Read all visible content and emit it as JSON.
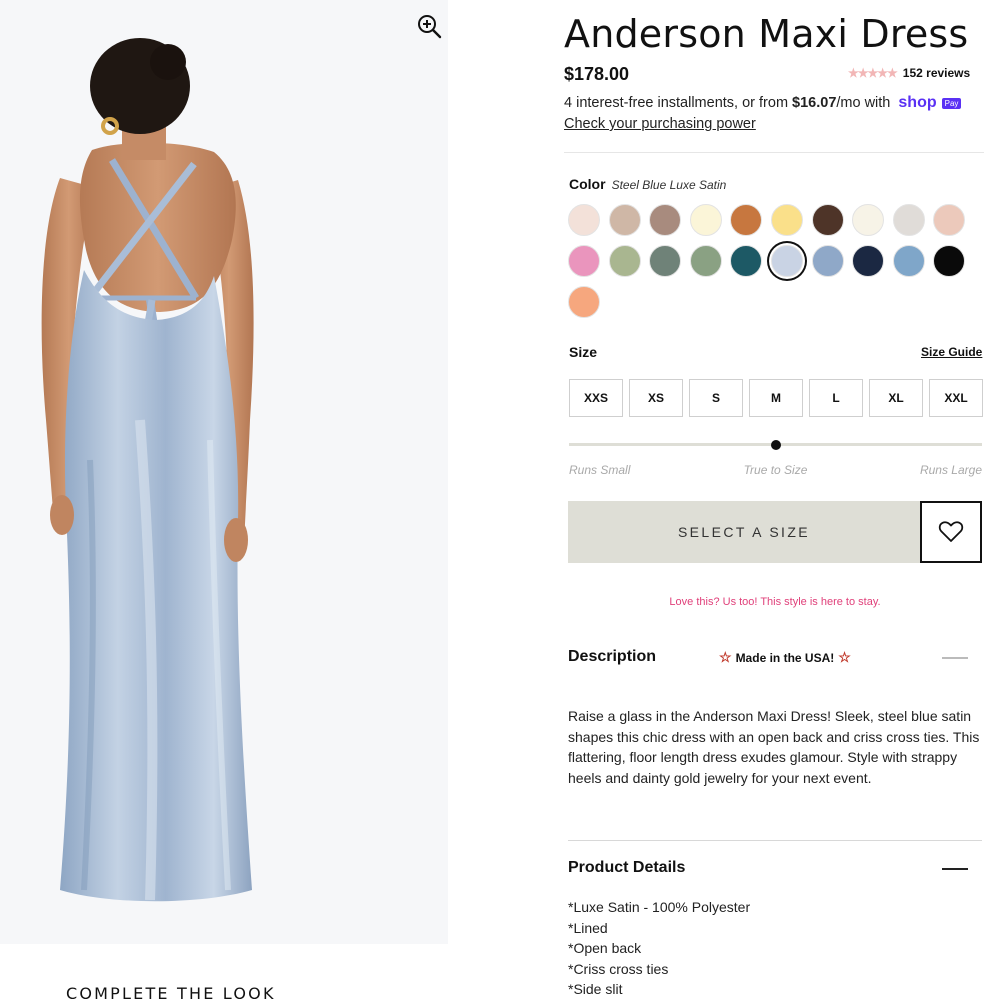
{
  "product": {
    "title": "Anderson Maxi Dress",
    "price": "$178.00",
    "reviews": "152 reviews",
    "rating_stars": "★★★★★",
    "installments_prefix": "4 interest-free installments, or from",
    "installments_amount": "$16.07",
    "installments_suffix": "/mo with",
    "shop_logo": "shop",
    "shop_pay_badge": "Pay",
    "check_power": "Check your purchasing power"
  },
  "color": {
    "label": "Color",
    "selected_name": "Steel Blue Luxe Satin",
    "swatches": [
      "#f3e1d9",
      "#cfb7a6",
      "#a88b7e",
      "#fbf5d8",
      "#c7773f",
      "#fae08a",
      "#4e3428",
      "#f7f3e7",
      "#e0dcd8",
      "#ecc9bb",
      "#ea95bd",
      "#a9b690",
      "#6f8278",
      "#8aa183",
      "#1d5965",
      "#c9d3e4",
      "#8fa8c8",
      "#1b2842",
      "#7fa6c9",
      "#0a0a0a",
      "#f6a77e"
    ],
    "selected_index": 15
  },
  "size": {
    "label": "Size",
    "guide": "Size Guide",
    "options": [
      "XXS",
      "XS",
      "S",
      "M",
      "L",
      "XL",
      "XXL"
    ],
    "fit_scale": [
      "Runs Small",
      "True to Size",
      "Runs Large"
    ],
    "fit_value": 0.5
  },
  "actions": {
    "select_size": "SELECT A SIZE",
    "wishlist_icon": "heart-icon"
  },
  "promo": "Love this? Us too! This style is here to stay.",
  "description": {
    "heading": "Description",
    "badge": "Made in the USA!",
    "body": "Raise a glass in the Anderson Maxi Dress! Sleek, steel blue satin shapes this chic dress with an open back and criss cross ties. This flattering, floor length dress exudes glamour. Style with strappy heels and dainty gold jewelry for your next event."
  },
  "details": {
    "heading": "Product Details",
    "items": [
      "*Luxe Satin - 100% Polyester",
      "*Lined",
      "*Open back",
      "*Criss cross ties",
      "*Side slit"
    ]
  },
  "complete_look": "COMPLETE THE LOOK",
  "icons": {
    "zoom": "zoom-in-icon",
    "star": "star-icon"
  }
}
